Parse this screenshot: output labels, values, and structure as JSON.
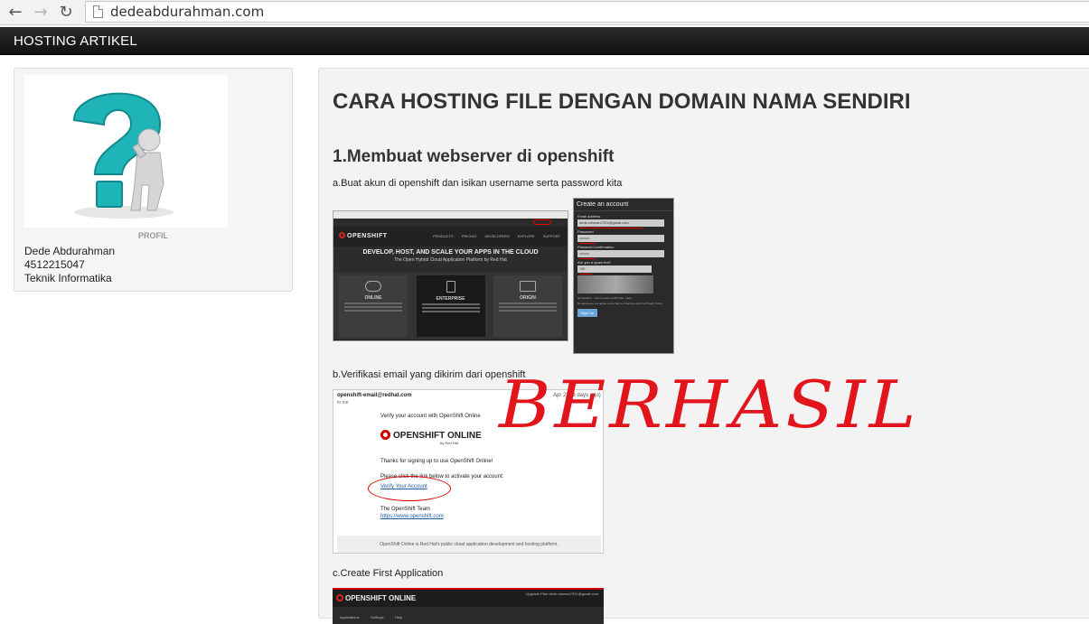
{
  "browser": {
    "url": "dedeabdurahman.com",
    "icons": [
      "back-arrow-icon",
      "forward-arrow-icon",
      "reload-icon",
      "page-icon"
    ]
  },
  "navbar": {
    "brand": "HOSTING ARTIKEL"
  },
  "sidebar": {
    "caption": "PROFIL",
    "name": "Dede Abdurahman",
    "id_number": "4512215047",
    "major": "Teknik Informatika"
  },
  "article": {
    "title": "CARA HOSTING FILE DENGAN DOMAIN NAMA SENDIRI",
    "section1_heading": "1.Membuat webserver di openshift",
    "step_a": "a.Buat akun di openshift dan isikan username serta password kita",
    "step_b": "b.Verifikasi email yang dikirim dari openshift",
    "step_c": "c.Create First Application"
  },
  "shot1": {
    "logo": "OPENSHIFT",
    "links": "PRODUCTS PRICING DEVELOPERS EXPLORE SUPPORT",
    "hero_title": "DEVELOP, HOST, AND SCALE YOUR APPS IN THE CLOUD",
    "hero_sub": "The Open Hybrid Cloud Application Platform by Red Hat",
    "cards": [
      "ONLINE",
      "ENTERPRISE",
      "ORIGIN"
    ]
  },
  "shot2": {
    "heading": "Create an account",
    "email_label": "Email address",
    "email_value": "dede.rahman7291@gmail.com",
    "password_label": "Password",
    "confirm_label": "Password confirmation",
    "spam_label": "Are you a spam bot?",
    "spam_value": "YEI",
    "button": "Sign Up"
  },
  "shot3": {
    "from": "openshift-email@redhat.com",
    "to": "to me",
    "date": "Apr 23 (3 days ago)",
    "intro": "Verify your account with OpenShift Online",
    "logo": "OPENSHIFT ONLINE",
    "by": "by Red Hat",
    "thanks": "Thanks for signing up to use OpenShift Online!",
    "click": "Please click the link below to activate your account:",
    "verify_link": "Verify Your Account",
    "team": "The OpenShift Team",
    "team_link": "https://www.openshift.com",
    "footer": "OpenShift Online is Red Hat's public cloud application development and hosting platform."
  },
  "shot4": {
    "logo": "OPENSHIFT ONLINE",
    "right": "Upgrade Plan   dede.rahman7291@gmail.com",
    "tabs": [
      "Applications",
      "Settings",
      "Help"
    ]
  },
  "overlay": {
    "text": "BERHASIL",
    "color": "#e2151d"
  },
  "colors": {
    "navbar": "#1b1b1b",
    "panel": "#f3f3f3",
    "accent_red": "#e2151d"
  }
}
